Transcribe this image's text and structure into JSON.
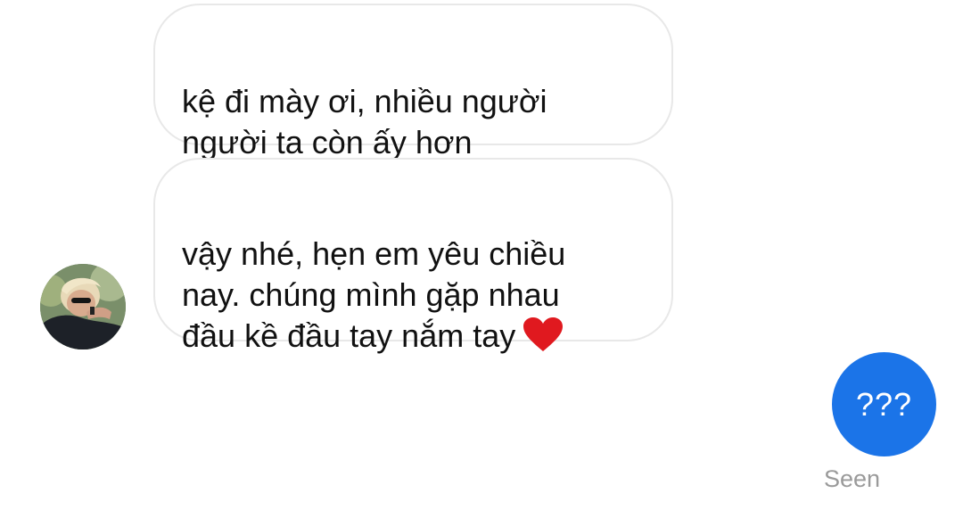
{
  "conversation": {
    "messages": [
      {
        "sender": "other",
        "text": "kệ đi mày ơi, nhiều người\nngười ta còn ấy hơn"
      },
      {
        "sender": "other",
        "text": "vậy nhé, hẹn em yêu chiều\nnay. chúng mình gặp nhau\nđầu kề đầu tay nắm tay",
        "emoji": "heart-icon"
      },
      {
        "sender": "me",
        "text": "???"
      }
    ],
    "status": "Seen"
  },
  "colors": {
    "sent_bubble": "#1b74e8",
    "received_border": "#e8e8e8",
    "heart": "#e0191f",
    "seen_text": "#9a9a9a"
  }
}
